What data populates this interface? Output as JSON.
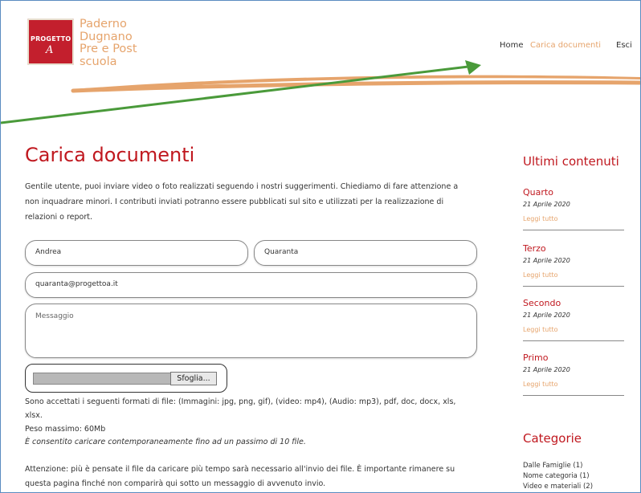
{
  "logo": {
    "line1": "PROGETTO",
    "line2": "A"
  },
  "brand": {
    "lines": [
      "Paderno",
      "Dugnano",
      "Pre e Post",
      "scuola"
    ]
  },
  "nav": {
    "home": "Home",
    "upload": "Carica documenti",
    "exit": "Esci"
  },
  "colors": {
    "accent": "#e6a46c",
    "title_red": "#c0181f",
    "arrow": "#4a9a3a",
    "logo_red": "#c31f2d"
  },
  "page": {
    "title": "Carica documenti",
    "intro": "Gentile utente, puoi inviare video o foto realizzati seguendo i nostri suggerimenti. Chiediamo di fare attenzione a non inquadrare minori. I contributi inviati potranno essere pubblicati sul sito e utilizzati per la realizzazione di relazioni o report."
  },
  "form": {
    "first_name": "Andrea",
    "last_name": "Quaranta",
    "email": "quaranta@progettoa.it",
    "message_placeholder": "Messaggio",
    "browse_label": "Sfoglia..."
  },
  "info": {
    "formats_line1": "Sono accettati i seguenti formati di file: (Immagini: jpg, png, gif), (video: mp4), (Audio: mp3), pdf, doc, docx, xls,",
    "formats_line2": "xlsx.",
    "max_size": "Peso massimo: 60Mb",
    "multi_note": "È consentito caricare contemporaneamente fino ad un passimo di 10 file.",
    "warning_line1": "Attenzione: più è pensate il file da caricare più tempo sarà necessario all'invio dei file. È importante rimanere su",
    "warning_line2": "questa pagina finché non comparirà qui sotto un messaggio di avvenuto invio."
  },
  "sidebar": {
    "latest_title": "Ultimi contenuti",
    "posts": [
      {
        "title": "Quarto",
        "date": "21 Aprile 2020",
        "link": "Leggi tutto"
      },
      {
        "title": "Terzo",
        "date": "21 Aprile 2020",
        "link": "Leggi tutto"
      },
      {
        "title": "Secondo",
        "date": "21 Aprile 2020",
        "link": "Leggi tutto"
      },
      {
        "title": "Primo",
        "date": "21 Aprile 2020",
        "link": "Leggi tutto"
      }
    ],
    "categories_title": "Categorie",
    "categories": [
      "Dalle Famiglie (1)",
      "Nome categoria (1)",
      "Video e materiali (2)"
    ]
  }
}
